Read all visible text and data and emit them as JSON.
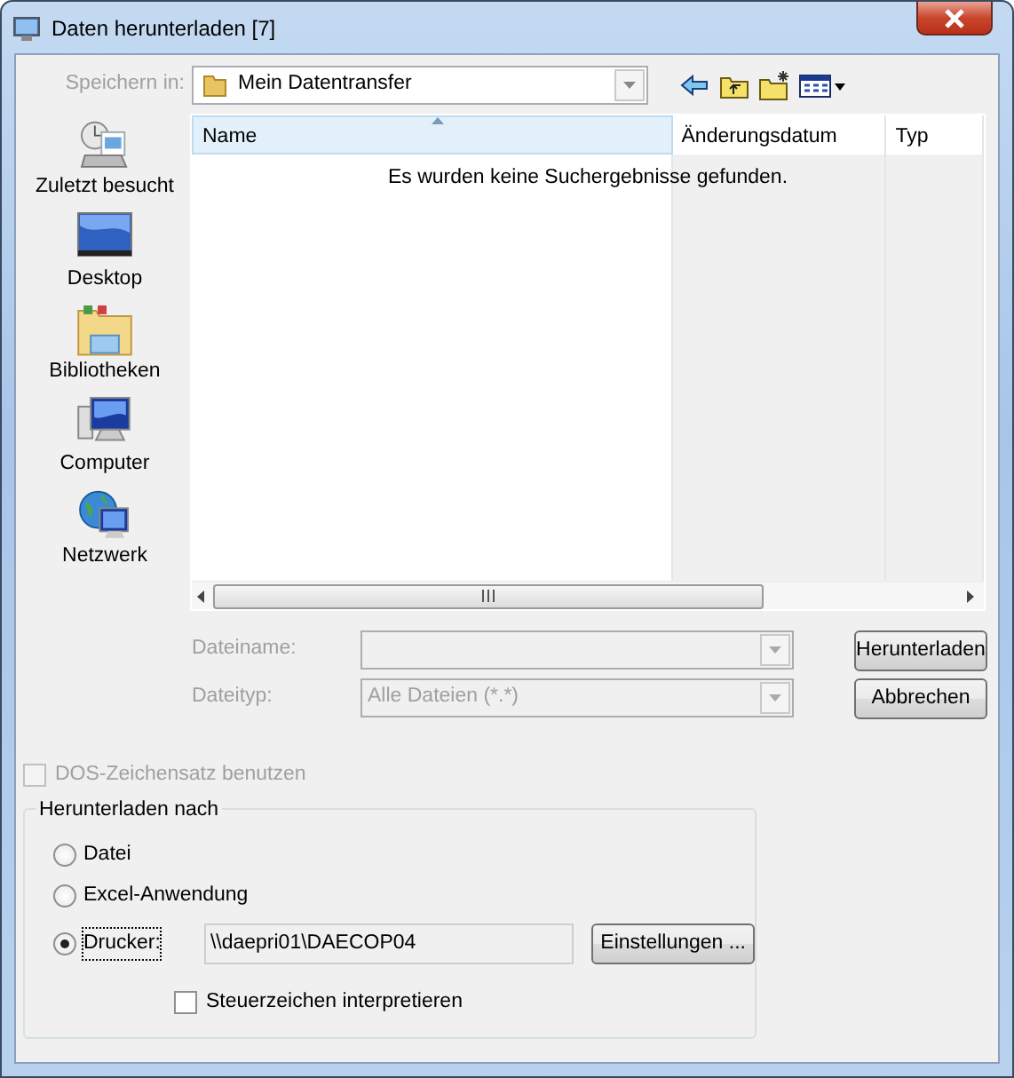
{
  "window": {
    "title": "Daten herunterladen [7]"
  },
  "save_in": {
    "label": "Speichern in:",
    "value": "Mein Datentransfer",
    "disabled": true
  },
  "places": [
    {
      "label": "Zuletzt besucht",
      "kind": "recent"
    },
    {
      "label": "Desktop",
      "kind": "desktop"
    },
    {
      "label": "Bibliotheken",
      "kind": "libraries"
    },
    {
      "label": "Computer",
      "kind": "computer"
    },
    {
      "label": "Netzwerk",
      "kind": "network"
    }
  ],
  "file_list": {
    "columns": [
      {
        "label": "Name",
        "sorted": true
      },
      {
        "label": "Änderungsdatum",
        "sorted": false
      },
      {
        "label": "Typ",
        "sorted": false
      }
    ],
    "empty_message": "Es wurden keine Suchergebnisse gefunden."
  },
  "file_name": {
    "label": "Dateiname:",
    "disabled": true
  },
  "file_type": {
    "label": "Dateityp:",
    "value": "Alle Dateien (*.*)",
    "disabled": true
  },
  "buttons": [
    {
      "label": "Herunterladen"
    },
    {
      "label": "Abbrechen"
    }
  ],
  "dos_charset": {
    "label": "DOS-Zeichensatz benutzen",
    "checked": false,
    "disabled": true
  },
  "download_to": {
    "title": "Herunterladen nach",
    "options": [
      {
        "label": "Datei",
        "selected": false
      },
      {
        "label": "Excel-Anwendung",
        "selected": false
      },
      {
        "label": "Drucker:",
        "selected": true
      }
    ],
    "printer": "\\\\daepri01\\DAECOP04",
    "settings_button": "Einstellungen ...",
    "interpret_control_chars": {
      "label": "Steuerzeichen interpretieren",
      "checked": false
    }
  }
}
